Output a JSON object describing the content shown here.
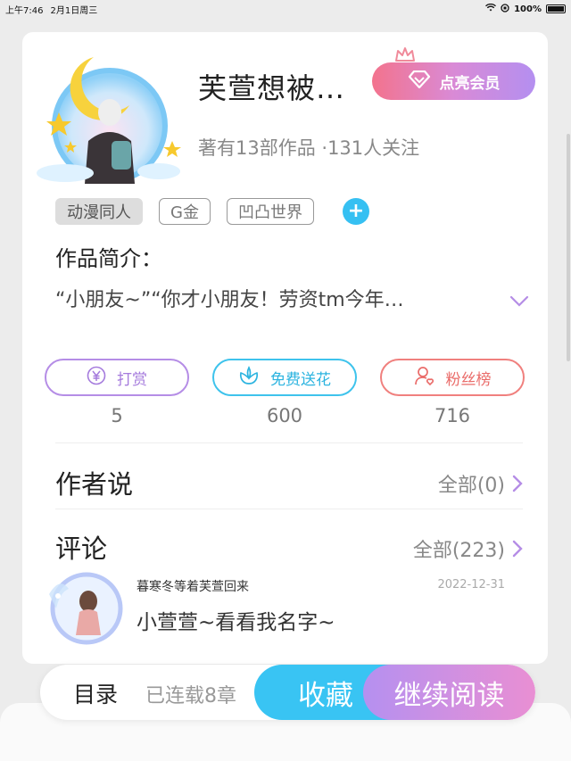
{
  "status_bar": {
    "time": "上午7:46",
    "date": "2月1日周三",
    "battery": "100%"
  },
  "work": {
    "title": "芙萱想被…",
    "vip_label": "点亮会员",
    "stats": "著有13部作品 ·131人关注",
    "tags": [
      "动漫同人",
      "G金",
      "凹凸世界"
    ],
    "tag_add": "+",
    "intro_label": "作品简介：",
    "intro_text": "“小朋友~”“你才小朋友！劳资tm今年…"
  },
  "actions": [
    {
      "label": "打赏",
      "count": "5",
      "icon": "yen-icon"
    },
    {
      "label": "免费送花",
      "count": "600",
      "icon": "flower-icon"
    },
    {
      "label": "粉丝榜",
      "count": "716",
      "icon": "fans-icon"
    }
  ],
  "author_says": {
    "title": "作者说",
    "more": "全部(0)"
  },
  "comments": {
    "title": "评论",
    "more": "全部(223)",
    "latest": {
      "user": "暮寒冬等着芙萱回来",
      "date": "2022-12-31",
      "text": "小萱萱~看看我名字~"
    }
  },
  "bottom_bar": {
    "toc": "目录",
    "serial": "已连载8章",
    "collect": "收藏",
    "read": "继续阅读"
  },
  "colors": {
    "accent_blue": "#39c4f3",
    "accent_purple": "#b590f0",
    "accent_pink": "#f3738d"
  }
}
